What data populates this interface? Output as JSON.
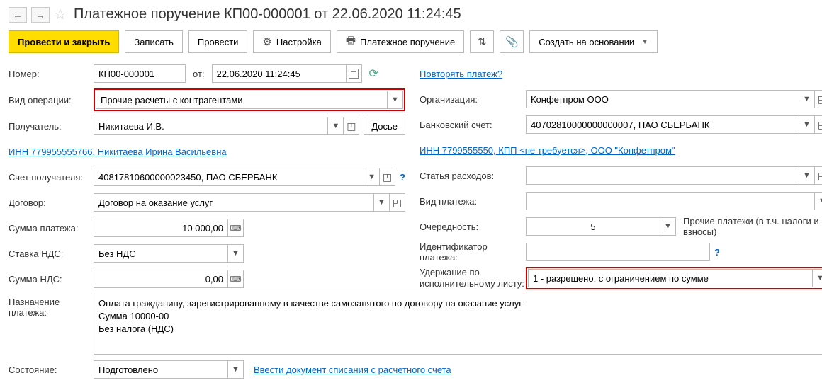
{
  "header": {
    "title": "Платежное поручение КП00-000001 от 22.06.2020 11:24:45"
  },
  "toolbar": {
    "save_close": "Провести и закрыть",
    "write": "Записать",
    "process": "Провести",
    "settings": "Настройка",
    "print": "Платежное поручение",
    "create_based": "Создать на основании"
  },
  "labels": {
    "number": "Номер:",
    "date_from": "от:",
    "operation_type": "Вид операции:",
    "recipient": "Получатель:",
    "recipient_account": "Счет получателя:",
    "contract": "Договор:",
    "payment_sum": "Сумма платежа:",
    "vat_rate": "Ставка НДС:",
    "vat_sum": "Сумма НДС:",
    "purpose": "Назначение платежа:",
    "state": "Состояние:",
    "repeat_link": "Повторять платеж?",
    "organization": "Организация:",
    "bank_account": "Банковский счет:",
    "expense_item": "Статья расходов:",
    "payment_type": "Вид платежа:",
    "priority": "Очередность:",
    "priority_desc": "Прочие платежи (в т.ч. налоги и взносы)",
    "payment_id": "Идентификатор платежа:",
    "enforcement": "Удержание по исполнительному листу:",
    "dossier": "Досье",
    "inn_recipient_link": "ИНН 779955555766, Никитаева Ирина Васильевна",
    "inn_org_link": "ИНН 7799555550, КПП <не требуется>, ООО \"Конфетпром\"",
    "writeoff_link": "Ввести документ списания с расчетного счета"
  },
  "values": {
    "number": "КП00-000001",
    "date": "22.06.2020 11:24:45",
    "operation_type": "Прочие расчеты с контрагентами",
    "recipient": "Никитаева И.В.",
    "recipient_account": "40817810600000023450, ПАО СБЕРБАНК",
    "contract": "Договор на оказание услуг",
    "payment_sum": "10 000,00",
    "vat_rate": "Без НДС",
    "vat_sum": "0,00",
    "purpose": "Оплата гражданину, зарегистрированному в качестве самозанятого по договору на оказание услуг\nСумма 10000-00\nБез налога (НДС)",
    "state": "Подготовлено",
    "organization": "Конфетпром ООО",
    "bank_account": "40702810000000000007, ПАО СБЕРБАНК",
    "expense_item": "",
    "payment_type": "",
    "priority": "5",
    "payment_id": "",
    "enforcement": "1 - разрешено, с ограничением по сумме"
  }
}
